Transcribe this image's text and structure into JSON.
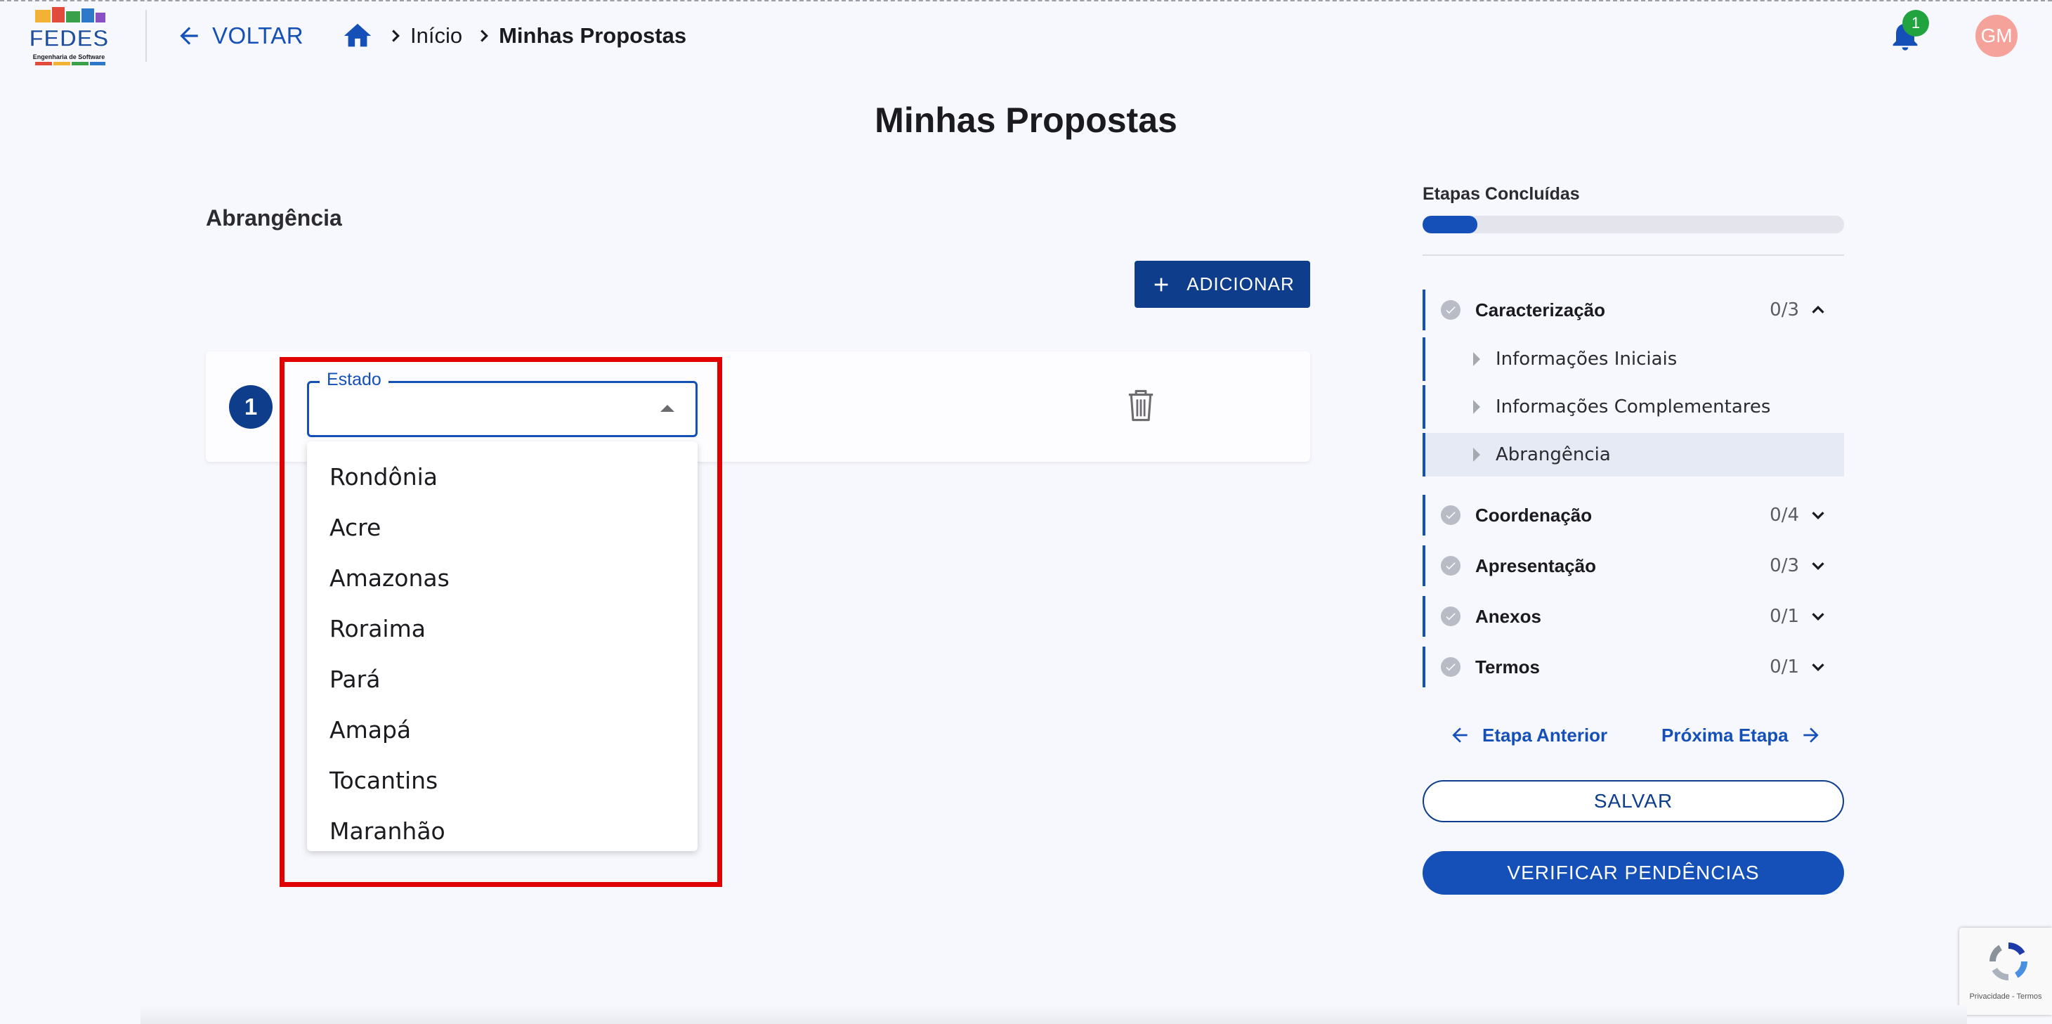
{
  "header": {
    "logo_text": "FEDES",
    "logo_subtext": "Engenharia de Software",
    "back_label": "VOLTAR",
    "breadcrumb": [
      "Início",
      "Minhas Propostas"
    ],
    "notification_count": "1",
    "avatar_initials": "GM"
  },
  "page": {
    "title": "Minhas Propostas",
    "section_title": "Abrangência",
    "add_label": "ADICIONAR"
  },
  "item": {
    "number": "1",
    "field_label": "Estado",
    "field_value": "",
    "options": [
      "Rondônia",
      "Acre",
      "Amazonas",
      "Roraima",
      "Pará",
      "Amapá",
      "Tocantins",
      "Maranhão"
    ]
  },
  "sidebar": {
    "progress_label": "Etapas Concluídas",
    "progress_fraction": 0.13,
    "steps": [
      {
        "label": "Caracterização",
        "count": "0/3",
        "expanded": true,
        "substeps": [
          "Informações Iniciais",
          "Informações Complementares",
          "Abrangência"
        ]
      },
      {
        "label": "Coordenação",
        "count": "0/4",
        "expanded": false
      },
      {
        "label": "Apresentação",
        "count": "0/3",
        "expanded": false
      },
      {
        "label": "Anexos",
        "count": "0/1",
        "expanded": false
      },
      {
        "label": "Termos",
        "count": "0/1",
        "expanded": false
      }
    ],
    "active_substep": "Abrangência",
    "prev_label": "Etapa Anterior",
    "next_label": "Próxima Etapa",
    "save_label": "SALVAR",
    "verify_label": "VERIFICAR PENDÊNCIAS"
  },
  "recaptcha": {
    "text": "Privacidade - Termos"
  },
  "colors": {
    "primary": "#1450b8",
    "primary_dark": "#0e3d8c",
    "highlight": "#e00000",
    "badge": "#21a340",
    "avatar": "#f5a29a"
  },
  "icons": [
    "arrow-left-icon",
    "home-icon",
    "chevron-right-icon",
    "bell-icon",
    "plus-icon",
    "trash-icon",
    "check-icon",
    "chevron-up-icon",
    "chevron-down-icon",
    "arrow-right-icon",
    "recaptcha-icon"
  ]
}
